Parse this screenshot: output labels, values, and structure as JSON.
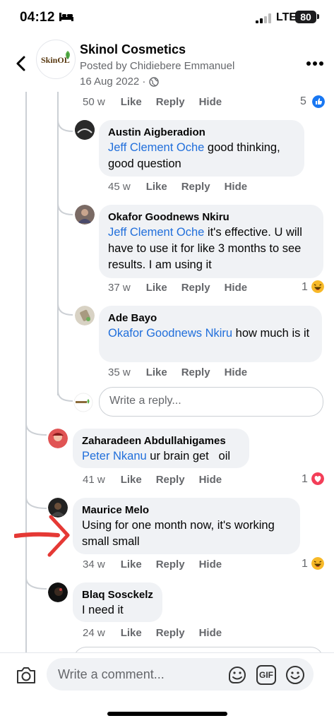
{
  "status_bar": {
    "time": "04:12",
    "network": "LTE",
    "battery": "80"
  },
  "header": {
    "page_name": "Skinol Cosmetics",
    "posted_by": "Posted by Chidiebere Emmanuel",
    "date": "16 Aug 2022 ·",
    "logo_text": "SkinOL"
  },
  "top_actions": {
    "time": "50 w",
    "like": "Like",
    "reply": "Reply",
    "hide": "Hide",
    "reaction_count": "5",
    "reaction": "like"
  },
  "replies": [
    {
      "author": "Austin Aigberadion",
      "mention": "Jeff Clement Oche",
      "text": " good thinking, good question",
      "time": "45 w",
      "like": "Like",
      "reply": "Reply",
      "hide": "Hide"
    },
    {
      "author": "Okafor Goodnews Nkiru",
      "mention": "Jeff Clement Oche",
      "text": " it's effective. U will have to use it for like 3 months to see results. I am using it",
      "time": "37 w",
      "like": "Like",
      "reply": "Reply",
      "hide": "Hide",
      "reaction_count": "1",
      "reaction": "haha"
    },
    {
      "author": "Ade Bayo",
      "mention": "Okafor Goodnews Nkiru",
      "text": " how much is it",
      "time": "35 w",
      "like": "Like",
      "reply": "Reply",
      "hide": "Hide"
    }
  ],
  "reply_box": {
    "placeholder": "Write a reply..."
  },
  "comments": [
    {
      "author": "Zaharadeen Abdullahigames",
      "mention": "Peter Nkanu",
      "text": " ur brain get   oil",
      "time": "41 w",
      "like": "Like",
      "reply": "Reply",
      "hide": "Hide",
      "reaction_count": "1",
      "reaction": "love"
    },
    {
      "author": "Maurice Melo",
      "mention": "",
      "text": "Using for one month now, it's working small small",
      "time": "34 w",
      "like": "Like",
      "reply": "Reply",
      "hide": "Hide",
      "reaction_count": "1",
      "reaction": "haha"
    },
    {
      "author": "Blaq Sosckelz",
      "mention": "",
      "text": "I need it",
      "time": "24 w",
      "like": "Like",
      "reply": "Reply",
      "hide": "Hide"
    }
  ],
  "composer": {
    "placeholder": "Write a comment...",
    "gif_label": "GIF"
  },
  "colors": {
    "link": "#216fdb",
    "muted": "#65676b",
    "bubble": "#f0f2f5",
    "annotation_arrow": "#e53935"
  }
}
